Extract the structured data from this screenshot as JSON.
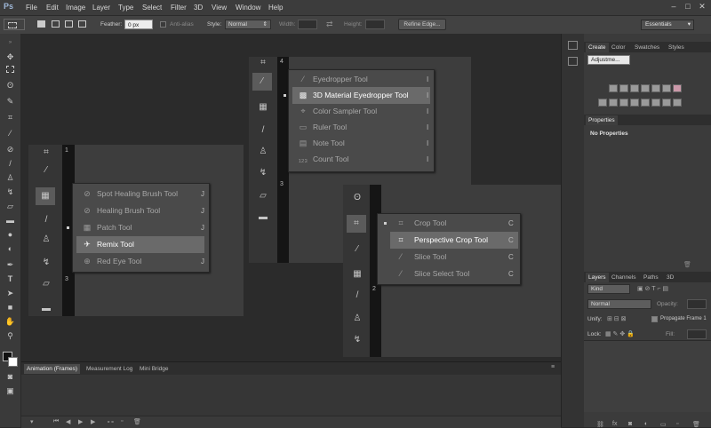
{
  "app": {
    "logo": "Ps"
  },
  "menu": [
    "File",
    "Edit",
    "Image",
    "Layer",
    "Type",
    "Select",
    "Filter",
    "3D",
    "View",
    "Window",
    "Help"
  ],
  "window_controls": [
    "–",
    "□",
    "✕"
  ],
  "options": {
    "feather_label": "Feather:",
    "feather_value": "0 px",
    "antialias_label": "Anti-alias",
    "style_label": "Style:",
    "style_value": "Normal",
    "width_label": "Width:",
    "height_label": "Height:",
    "refine_edge": "Refine Edge...",
    "workspace": "Essentials"
  },
  "canvas": {
    "shot1": {
      "ruler_numbers": [
        "1",
        "3"
      ],
      "flyout": [
        {
          "icon": "spot-healing-icon",
          "label": "Spot Healing Brush Tool",
          "shortcut": "J",
          "active": false
        },
        {
          "icon": "healing-brush-icon",
          "label": "Healing Brush Tool",
          "shortcut": "J",
          "active": false
        },
        {
          "icon": "patch-icon",
          "label": "Patch Tool",
          "shortcut": "J",
          "active": false,
          "bullet": true
        },
        {
          "icon": "remix-icon",
          "label": "Remix Tool",
          "shortcut": "",
          "active": true
        },
        {
          "icon": "red-eye-icon",
          "label": "Red Eye Tool",
          "shortcut": "J",
          "active": false
        }
      ]
    },
    "shot2": {
      "ruler_numbers": [
        "4",
        "3"
      ],
      "flyout": [
        {
          "icon": "eyedropper-icon",
          "label": "Eyedropper Tool",
          "shortcut": "I",
          "active": false
        },
        {
          "icon": "3d-eyedropper-icon",
          "label": "3D Material Eyedropper Tool",
          "shortcut": "I",
          "active": true,
          "bullet": true
        },
        {
          "icon": "color-sampler-icon",
          "label": "Color Sampler Tool",
          "shortcut": "I",
          "active": false
        },
        {
          "icon": "ruler-icon",
          "label": "Ruler Tool",
          "shortcut": "I",
          "active": false
        },
        {
          "icon": "note-icon",
          "label": "Note Tool",
          "shortcut": "I",
          "active": false
        },
        {
          "icon": "count-icon",
          "label": "Count Tool",
          "shortcut": "I",
          "active": false
        }
      ]
    },
    "shot3": {
      "ruler_numbers": [
        "2"
      ],
      "flyout": [
        {
          "icon": "crop-icon",
          "label": "Crop Tool",
          "shortcut": "C",
          "active": false,
          "bullet": true
        },
        {
          "icon": "perspective-crop-icon",
          "label": "Perspective Crop Tool",
          "shortcut": "C",
          "active": true
        },
        {
          "icon": "slice-icon",
          "label": "Slice Tool",
          "shortcut": "C",
          "active": false
        },
        {
          "icon": "slice-select-icon",
          "label": "Slice Select Tool",
          "shortcut": "C",
          "active": false
        }
      ]
    }
  },
  "timeline": {
    "tabs": [
      "Animation (Frames)",
      "Measurement Log",
      "Mini Bridge"
    ]
  },
  "panels": {
    "top_tabs": [
      "Create",
      "Color",
      "Swatches",
      "Styles"
    ],
    "adjustments_select": "Adjustme...",
    "properties_tab": "Properties",
    "no_properties": "No Properties",
    "layer_tabs": [
      "Layers",
      "Channels",
      "Paths",
      "3D"
    ],
    "kind": "Kind",
    "blend_mode": "Normal",
    "opacity_label": "Opacity:",
    "unify_label": "Unify:",
    "propagate": "Propagate Frame 1",
    "lock_label": "Lock:",
    "fill_label": "Fill:"
  },
  "colors": {
    "highlight": "#6a6a6a",
    "flyout_bg": "#4a4a4a",
    "app_bg": "#282828"
  }
}
